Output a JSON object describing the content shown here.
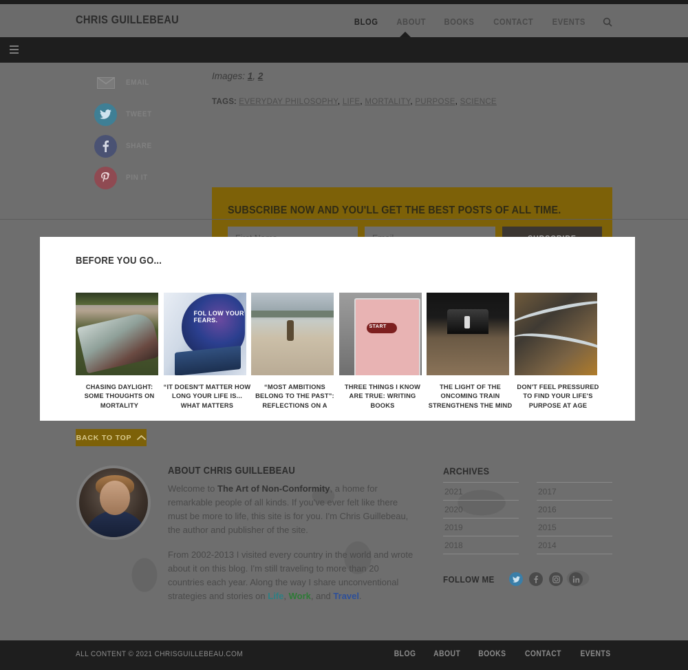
{
  "header": {
    "brand": "CHRIS GUILLEBEAU",
    "nav": [
      {
        "label": "BLOG",
        "active": true
      },
      {
        "label": "ABOUT",
        "active": false
      },
      {
        "label": "BOOKS",
        "active": false
      },
      {
        "label": "CONTACT",
        "active": false
      },
      {
        "label": "EVENTS",
        "active": false
      }
    ],
    "search_icon": "search-icon",
    "menu_icon": "hamburger-icon"
  },
  "share_rail": [
    {
      "label": "EMAIL",
      "icon": "envelope-icon",
      "color": "#6e6e6e"
    },
    {
      "label": "TWEET",
      "icon": "twitter-icon",
      "color": "#3f7f95"
    },
    {
      "label": "SHARE",
      "icon": "facebook-icon",
      "color": "#4a5273"
    },
    {
      "label": "PIN IT",
      "icon": "pinterest-icon",
      "color": "#8f4a52"
    }
  ],
  "article": {
    "images_label": "Images:",
    "image_links": [
      "1",
      "2"
    ],
    "tags_label": "TAGS",
    "tags": [
      "EVERYDAY PHILOSOPHY",
      "LIFE",
      "MORTALITY",
      "PURPOSE",
      "SCIENCE"
    ]
  },
  "subscribe": {
    "title": "SUBSCRIBE NOW AND YOU'LL GET THE BEST POSTS OF ALL TIME.",
    "first_name_placeholder": "First Name",
    "first_name_value": "",
    "email_placeholder": "Email",
    "email_value": "",
    "button_label": "SUBSCRIBE",
    "background_color": "#7d6108"
  },
  "before_you_go": {
    "title": "BEFORE YOU GO...",
    "posts": [
      {
        "caption": "CHASING DAYLIGHT: SOME THOUGHTS ON MORTALITY",
        "image": "beached-boat-photo",
        "art": "art1",
        "overlay": ""
      },
      {
        "caption": "“IT DOESN'T MATTER HOW LONG YOUR LIFE IS... WHAT MATTERS",
        "image": "follow-your-fears-plane-photo",
        "art": "art2",
        "overlay": "FOL LOW YOUR FEARS."
      },
      {
        "caption": "“MOST AMBITIONS BELONG TO THE PAST”: REFLECTIONS ON A",
        "image": "person-on-beach-photo",
        "art": "art3",
        "overlay": ""
      },
      {
        "caption": "THREE THINGS I KNOW ARE TRUE: WRITING BOOKS",
        "image": "start-notebook-photo",
        "art": "art4",
        "overlay": "START"
      },
      {
        "caption": "THE LIGHT OF THE ONCOMING TRAIN STRENGTHENS THE MIND",
        "image": "railroad-tracks-photo",
        "art": "art5",
        "overlay": ""
      },
      {
        "caption": "DON'T FEEL PRESSURED TO FIND YOUR LIFE'S PURPOSE AT AGE",
        "image": "aerial-winding-roads-photo",
        "art": "art6",
        "overlay": ""
      }
    ]
  },
  "back_to_top": {
    "label": "BACK TO TOP",
    "icon": "chevron-up-icon"
  },
  "about": {
    "title": "ABOUT CHRIS GUILLEBEAU",
    "avatar": "chris-guillebeau-portrait",
    "paragraph1_pre": "Welcome to ",
    "paragraph1_bold": "The Art of Non-Conformity",
    "paragraph1_post": ", a home for remarkable people of all kinds. If you've ever felt like there must be more to life, this site is for you. I'm Chris Guillebeau, the author and publisher of the site.",
    "paragraph2_pre": "From 2002-2013 I visited every country in the world and wrote about it on this blog. I'm still traveling to more than 20 countries each year. Along the way I share unconventional strategies and stories on ",
    "link_life": "Life",
    "link_work": "Work",
    "link_travel": "Travel",
    "paragraph2_sep1": ", ",
    "paragraph2_sep2": ", and ",
    "paragraph2_end": "."
  },
  "archives": {
    "title": "ARCHIVES",
    "left_column": [
      "2021",
      "2020",
      "2019",
      "2018"
    ],
    "right_column": [
      "2017",
      "2016",
      "2015",
      "2014"
    ]
  },
  "follow": {
    "label": "FOLLOW ME",
    "icons": [
      {
        "name": "twitter-icon",
        "color": "#3a7ea8"
      },
      {
        "name": "facebook-icon",
        "color": "#4a4a4a"
      },
      {
        "name": "instagram-icon",
        "color": "#4a4a4a"
      },
      {
        "name": "linkedin-icon",
        "color": "#4a4a4a"
      }
    ]
  },
  "footer": {
    "copyright": "ALL CONTENT © 2021 CHRISGUILLEBEAU.COM",
    "nav": [
      "BLOG",
      "ABOUT",
      "BOOKS",
      "CONTACT",
      "EVENTS"
    ]
  }
}
